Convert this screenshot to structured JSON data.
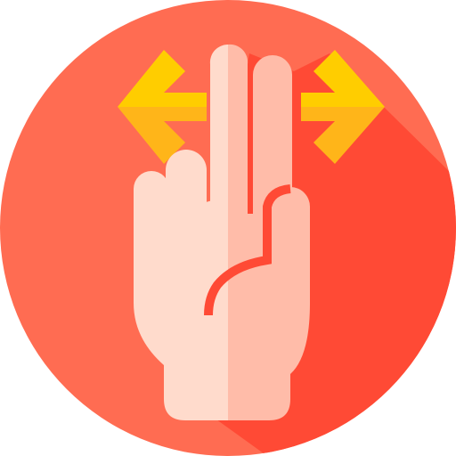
{
  "icon": {
    "name": "two-finger-spread-gesture-icon",
    "colors": {
      "circle": "#ff6c52",
      "circle_shadow": "#ff4a35",
      "hand_light": "#ffdbcc",
      "hand_dark": "#ffbca9",
      "crease": "#ff4a35",
      "arrow_light": "#ffcd00",
      "arrow_dark": "#ffb519"
    }
  }
}
